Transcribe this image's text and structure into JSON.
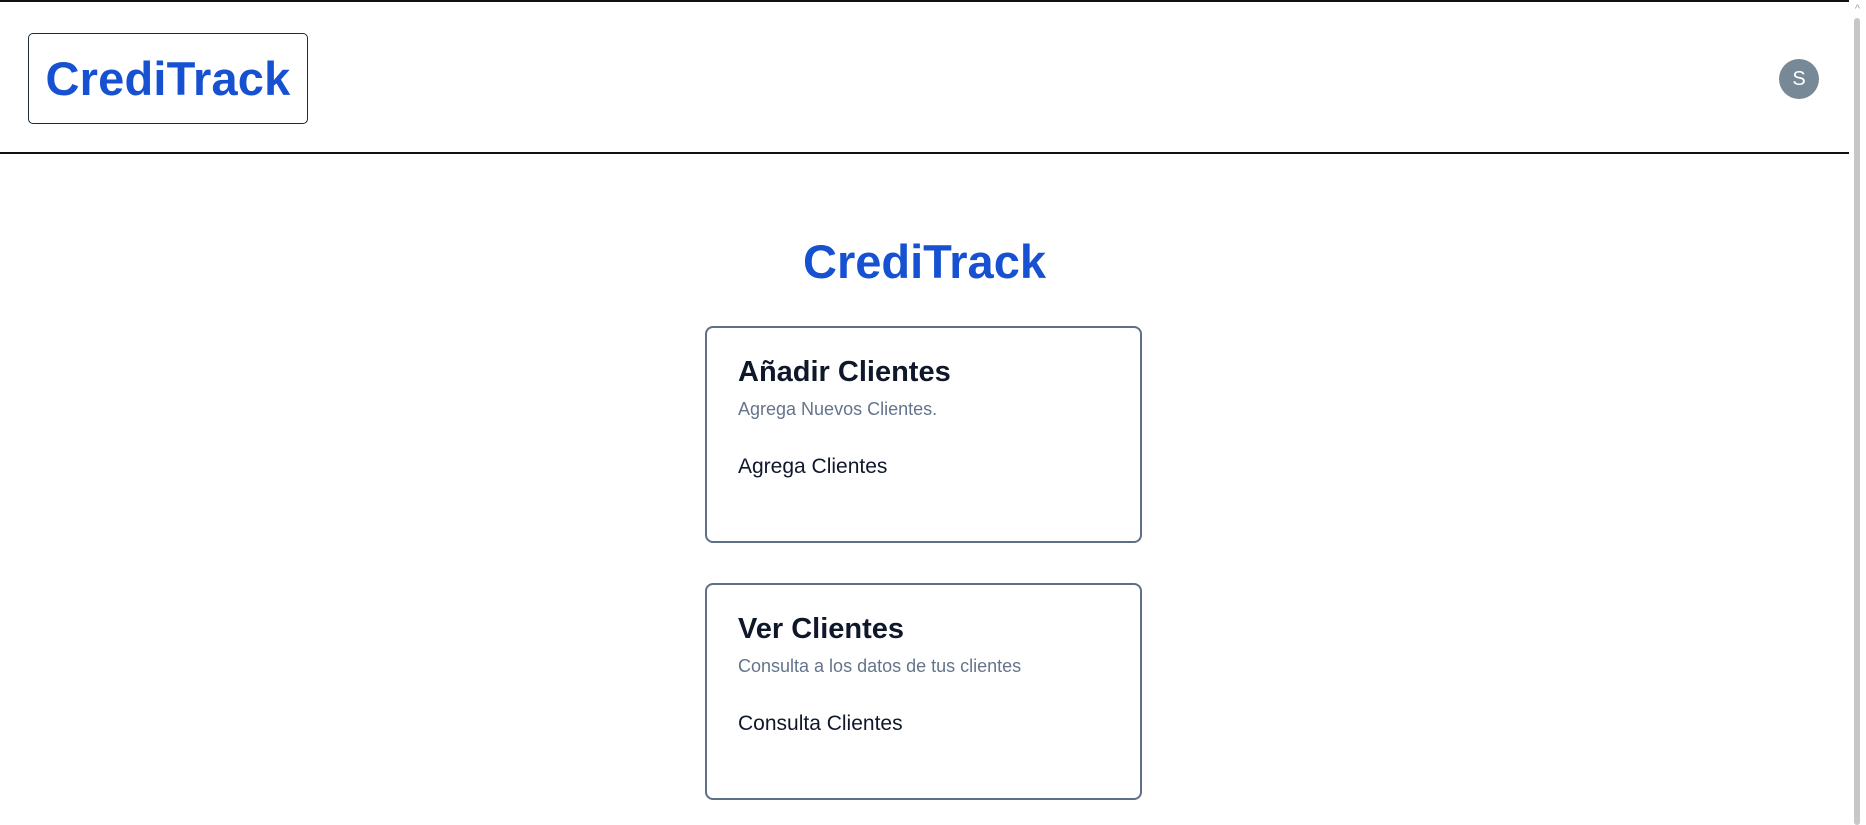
{
  "header": {
    "logo": "CrediTrack",
    "avatar_initial": "S"
  },
  "main": {
    "title": "CrediTrack",
    "cards": [
      {
        "title": "Añadir Clientes",
        "description": "Agrega Nuevos Clientes.",
        "content": "Agrega Clientes"
      },
      {
        "title": "Ver Clientes",
        "description": "Consulta a los datos de tus clientes",
        "content": "Consulta Clientes"
      }
    ]
  },
  "scrollbar": {
    "up_arrow_icon": "chevron-up-icon"
  },
  "colors": {
    "brand": "#1551d1",
    "avatar_bg": "#778996",
    "card_border": "#5f6f86",
    "muted_text": "#64748b"
  }
}
